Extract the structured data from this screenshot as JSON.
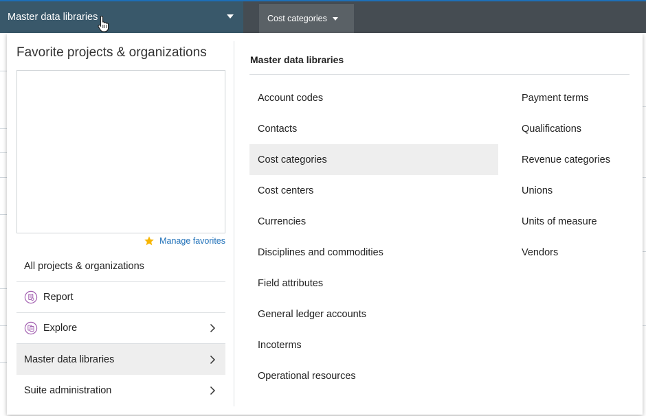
{
  "header": {
    "module_label": "Master data libraries",
    "current_tab_label": "Cost categories",
    "colors": {
      "topbar": "#454c52",
      "module_selector": "#39586a",
      "tab": "#5a6166",
      "accent": "#1d6fb8"
    }
  },
  "favorites": {
    "title": "Favorite projects & organizations",
    "manage_label": "Manage favorites",
    "star_color": "#f7b500"
  },
  "left_menu": [
    {
      "label": "All projects & organizations"
    },
    {
      "label": "Report",
      "icon": "report-icon"
    },
    {
      "label": "Explore",
      "icon": "explore-icon"
    },
    {
      "label": "Master data libraries"
    },
    {
      "label": "Suite administration"
    }
  ],
  "libraries": {
    "title": "Master data libraries",
    "column1": [
      "Account codes",
      "Contacts",
      "Cost categories",
      "Cost centers",
      "Currencies",
      "Disciplines and commodities",
      "Field attributes",
      "General ledger accounts",
      "Incoterms",
      "Operational resources"
    ],
    "column2": [
      "Payment terms",
      "Qualifications",
      "Revenue categories",
      "Unions",
      "Units of measure",
      "Vendors"
    ],
    "selected": "Cost categories"
  }
}
